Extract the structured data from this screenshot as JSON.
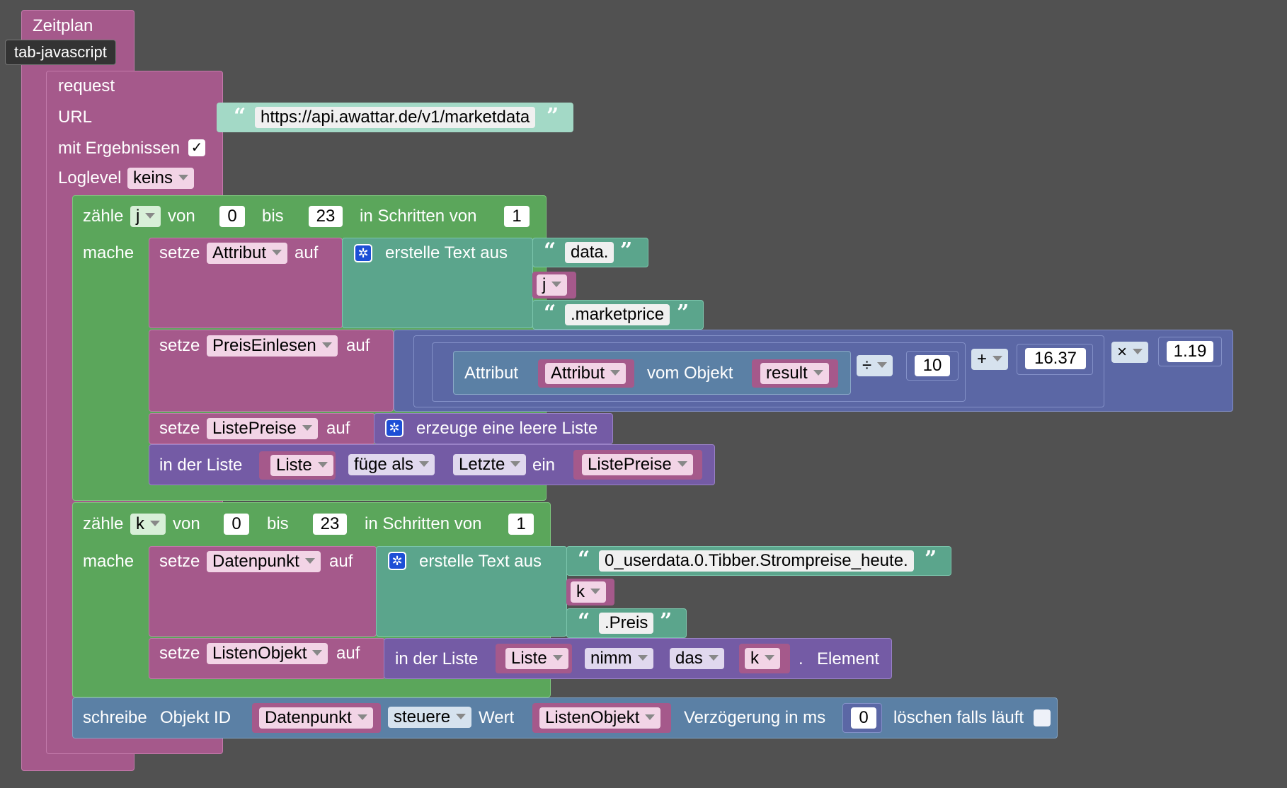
{
  "tooltip": "tab-javascript",
  "schedule": {
    "label": "Zeitplan"
  },
  "request": {
    "label": "request",
    "url_label": "URL",
    "url_value": "https://api.awattar.de/v1/marketdata",
    "results_label": "mit Ergebnissen",
    "results_checked": "✓",
    "loglevel_label": "Loglevel",
    "loglevel_value": "keins"
  },
  "loop1": {
    "count_label": "zähle",
    "var": "j",
    "from_label": "von",
    "from": "0",
    "to_label": "bis",
    "to": "23",
    "step_label": "in Schritten von",
    "step": "1",
    "do_label": "mache"
  },
  "set_attr": {
    "set": "setze",
    "var": "Attribut",
    "to": "auf",
    "create_text": "erstelle Text aus",
    "parts": [
      "data.",
      "j",
      ".marketprice"
    ]
  },
  "set_price": {
    "set": "setze",
    "var": "PreisEinlesen",
    "to": "auf",
    "attr_label": "Attribut",
    "attr_var": "Attribut",
    "of_object": "vom Objekt",
    "object_var": "result",
    "div_op": "÷",
    "div_val": "10",
    "add_op": "+",
    "add_val": "16.37",
    "mul_op": "×",
    "mul_val": "1.19"
  },
  "set_list": {
    "set": "setze",
    "var": "ListePreise",
    "to": "auf",
    "create_list": "erzeuge eine leere Liste"
  },
  "insert": {
    "in_list": "in der Liste",
    "list_var": "Liste",
    "mode": "füge als",
    "where": "Letzte",
    "ein": "ein",
    "value_var": "ListePreise"
  },
  "loop2": {
    "count_label": "zähle",
    "var": "k",
    "from_label": "von",
    "from": "0",
    "to_label": "bis",
    "to": "23",
    "step_label": "in Schritten von",
    "step": "1",
    "do_label": "mache"
  },
  "set_dp": {
    "set": "setze",
    "var": "Datenpunkt",
    "to": "auf",
    "create_text": "erstelle Text aus",
    "parts": [
      "0_userdata.0.Tibber.Strompreise_heute.",
      "k",
      ".Preis"
    ]
  },
  "set_listobj": {
    "set": "setze",
    "var": "ListenObjekt",
    "to": "auf",
    "in_list": "in der Liste",
    "list_var": "Liste",
    "op": "nimm",
    "which": "das",
    "index_var": "k",
    "dot": ".",
    "element": "Element"
  },
  "write": {
    "label": "schreibe",
    "object_id": "Objekt ID",
    "id_var": "Datenpunkt",
    "mode": "steuere",
    "value_label": "Wert",
    "value_var": "ListenObjekt",
    "delay_label": "Verzögerung in ms",
    "delay": "0",
    "clear_label": "löschen falls läuft"
  },
  "colors": {
    "background": "#515151",
    "variables": "#a5598b",
    "loops": "#5ba65b",
    "text": "#5ba58c",
    "lists": "#745ba5",
    "math": "#5b67a5",
    "io": "#5b80a5"
  }
}
